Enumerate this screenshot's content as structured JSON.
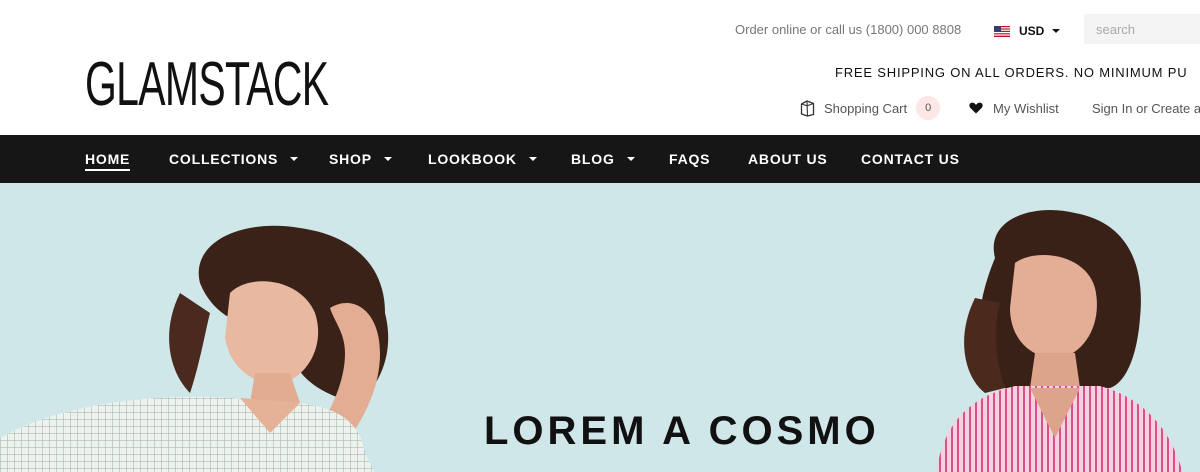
{
  "brand": {
    "logo_text": "GLAMSTACK"
  },
  "topbar": {
    "phone_text": "Order online or call us (1800) 000 8808",
    "currency": {
      "label": "USD",
      "flag_icon": "us-flag-icon"
    },
    "search": {
      "placeholder": "search",
      "value": ""
    }
  },
  "promo": {
    "text": "FREE SHIPPING ON ALL ORDERS. NO MINIMUM PU"
  },
  "account": {
    "cart": {
      "label": "Shopping Cart",
      "count": "0",
      "icon": "shopping-bag-icon"
    },
    "wishlist": {
      "label": "My Wishlist",
      "icon": "heart-icon"
    },
    "signin": {
      "label": "Sign In or Create a"
    }
  },
  "nav": {
    "items": [
      {
        "label": "HOME",
        "active": true,
        "dropdown": false
      },
      {
        "label": "COLLECTIONS",
        "dropdown": true
      },
      {
        "label": "SHOP",
        "dropdown": true
      },
      {
        "label": "LOOKBOOK",
        "dropdown": true
      },
      {
        "label": "BLOG",
        "dropdown": true
      },
      {
        "label": "FAQS",
        "dropdown": false
      },
      {
        "label": "ABOUT US",
        "dropdown": false
      },
      {
        "label": "CONTACT US",
        "dropdown": false
      }
    ]
  },
  "hero": {
    "title": "LOREM A COSMO"
  },
  "colors": {
    "nav_background": "#161616",
    "hero_background": "#cfe7e9",
    "cart_badge": "#fce6e6",
    "text_dark": "#111111",
    "text_muted": "#777777"
  }
}
